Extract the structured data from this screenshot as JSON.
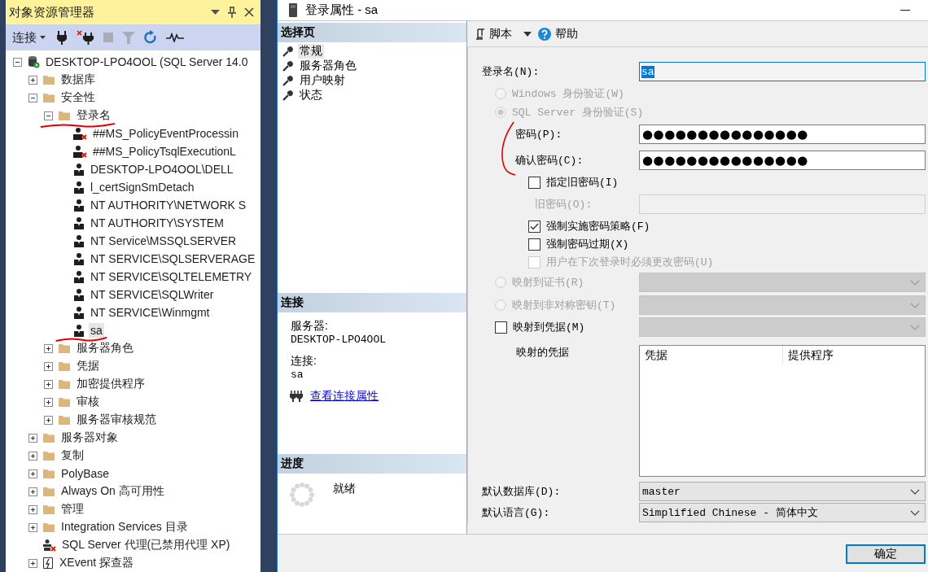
{
  "object_explorer": {
    "title": "对象资源管理器",
    "toolbar": {
      "connect_label": "连接",
      "tools": [
        {
          "kind": "connect",
          "disabled": false
        },
        {
          "kind": "disconnect",
          "disabled": false
        },
        {
          "kind": "stop",
          "disabled": true
        },
        {
          "kind": "filter",
          "disabled": true
        },
        {
          "kind": "refresh",
          "disabled": false
        },
        {
          "kind": "activity",
          "disabled": false
        }
      ]
    },
    "tree": [
      {
        "label": "DESKTOP-LPO4OOL (SQL Server 14.0",
        "kind": "server",
        "expanded": true,
        "selected": false,
        "children": [
          {
            "label": "数据库",
            "kind": "folder",
            "expanded": false,
            "selected": false
          },
          {
            "label": "安全性",
            "kind": "folder",
            "expanded": true,
            "selected": false,
            "children": [
              {
                "label": "登录名",
                "kind": "folder",
                "expanded": true,
                "selected": false,
                "annotated": true,
                "children": [
                  {
                    "label": "##MS_PolicyEventProcessin",
                    "kind": "login-disabled",
                    "selected": false
                  },
                  {
                    "label": "##MS_PolicyTsqlExecutionL",
                    "kind": "login-disabled",
                    "selected": false
                  },
                  {
                    "label": "DESKTOP-LPO4OOL\\DELL",
                    "kind": "login",
                    "selected": false
                  },
                  {
                    "label": "l_certSignSmDetach",
                    "kind": "login",
                    "selected": false
                  },
                  {
                    "label": "NT AUTHORITY\\NETWORK S",
                    "kind": "login",
                    "selected": false
                  },
                  {
                    "label": "NT AUTHORITY\\SYSTEM",
                    "kind": "login",
                    "selected": false
                  },
                  {
                    "label": "NT Service\\MSSQLSERVER",
                    "kind": "login",
                    "selected": false
                  },
                  {
                    "label": "NT SERVICE\\SQLSERVERAGE",
                    "kind": "login",
                    "selected": false
                  },
                  {
                    "label": "NT SERVICE\\SQLTELEMETRY",
                    "kind": "login",
                    "selected": false
                  },
                  {
                    "label": "NT SERVICE\\SQLWriter",
                    "kind": "login",
                    "selected": false
                  },
                  {
                    "label": "NT SERVICE\\Winmgmt",
                    "kind": "login",
                    "selected": false
                  },
                  {
                    "label": "sa",
                    "kind": "login",
                    "selected": true,
                    "annotated": true
                  }
                ]
              },
              {
                "label": "服务器角色",
                "kind": "folder",
                "expanded": false,
                "selected": false
              },
              {
                "label": "凭据",
                "kind": "folder",
                "expanded": false,
                "selected": false
              },
              {
                "label": "加密提供程序",
                "kind": "folder",
                "expanded": false,
                "selected": false
              },
              {
                "label": "审核",
                "kind": "folder",
                "expanded": false,
                "selected": false
              },
              {
                "label": "服务器审核规范",
                "kind": "folder",
                "expanded": false,
                "selected": false
              }
            ]
          },
          {
            "label": "服务器对象",
            "kind": "folder",
            "expanded": false,
            "selected": false
          },
          {
            "label": "复制",
            "kind": "folder",
            "expanded": false,
            "selected": false
          },
          {
            "label": "PolyBase",
            "kind": "folder",
            "expanded": false,
            "selected": false
          },
          {
            "label": "Always On 高可用性",
            "kind": "folder",
            "expanded": false,
            "selected": false
          },
          {
            "label": "管理",
            "kind": "folder",
            "expanded": false,
            "selected": false
          },
          {
            "label": "Integration Services 目录",
            "kind": "folder",
            "expanded": false,
            "selected": false
          },
          {
            "label": "SQL Server 代理(已禁用代理 XP)",
            "kind": "agent",
            "selected": false
          },
          {
            "label": "XEvent 探查器",
            "kind": "xevent",
            "expanded": false,
            "selected": false
          }
        ]
      }
    ]
  },
  "dialog": {
    "title": "登录属性 - sa",
    "pages": {
      "header": "选择页",
      "items": [
        {
          "label": "常规",
          "selected": true
        },
        {
          "label": "服务器角色",
          "selected": false
        },
        {
          "label": "用户映射",
          "selected": false
        },
        {
          "label": "状态",
          "selected": false
        }
      ]
    },
    "connection": {
      "header": "连接",
      "server_label": "服务器:",
      "server": "DESKTOP-LPO4OOL",
      "connection_label": "连接:",
      "connection": "sa",
      "link": "查看连接属性"
    },
    "progress": {
      "header": "进度",
      "status": "就绪"
    },
    "toolbar": {
      "script": "脚本",
      "help": "帮助"
    },
    "form": {
      "rows": [
        {
          "kind": "field",
          "label": "登录名(N):",
          "value": "sa",
          "value_selected": true
        },
        {
          "kind": "radio",
          "label": "Windows 身份验证(W)",
          "checked": false,
          "disabled": true
        },
        {
          "kind": "radio",
          "label": "SQL Server 身份验证(S)",
          "checked": true,
          "disabled": true,
          "annotated": true,
          "children": [
            {
              "kind": "password",
              "label": "密码(P):",
              "value": "●●●●●●●●●●●●●●●",
              "disabled": false
            },
            {
              "kind": "password",
              "label": "确认密码(C):",
              "value": "●●●●●●●●●●●●●●●",
              "disabled": false
            },
            {
              "kind": "checkbox",
              "label": "指定旧密码(I)",
              "checked": false,
              "disabled": false,
              "children": [
                {
                  "kind": "password",
                  "label": "旧密码(O):",
                  "disabled": true
                }
              ]
            },
            {
              "kind": "checkbox",
              "label": "强制实施密码策略(F)",
              "checked": true,
              "disabled": false
            },
            {
              "kind": "checkbox",
              "label": "强制密码过期(X)",
              "checked": false,
              "disabled": false
            },
            {
              "kind": "checkbox",
              "label": "用户在下次登录时必须更改密码(U)",
              "checked": false,
              "disabled": true
            }
          ]
        },
        {
          "kind": "radio",
          "label": "映射到证书(R)",
          "checked": false,
          "disabled": true,
          "dropdown": {
            "disabled": true
          }
        },
        {
          "kind": "radio",
          "label": "映射到非对称密钥(T)",
          "checked": false,
          "disabled": true,
          "dropdown": {
            "disabled": true
          }
        },
        {
          "kind": "checkbox",
          "label": "映射到凭据(M)",
          "checked": false,
          "disabled": false,
          "dropdown": {
            "disabled": true
          }
        },
        {
          "kind": "grid",
          "label": "映射的凭据",
          "columns": [
            "凭据",
            "提供程序"
          ]
        },
        {
          "kind": "dropdown",
          "label": "默认数据库(D):",
          "value": "master",
          "disabled": false
        },
        {
          "kind": "dropdown",
          "label": "默认语言(G):",
          "value": "Simplified Chinese - 简体中文",
          "disabled": false
        }
      ]
    },
    "buttons": [
      "确定"
    ]
  }
}
